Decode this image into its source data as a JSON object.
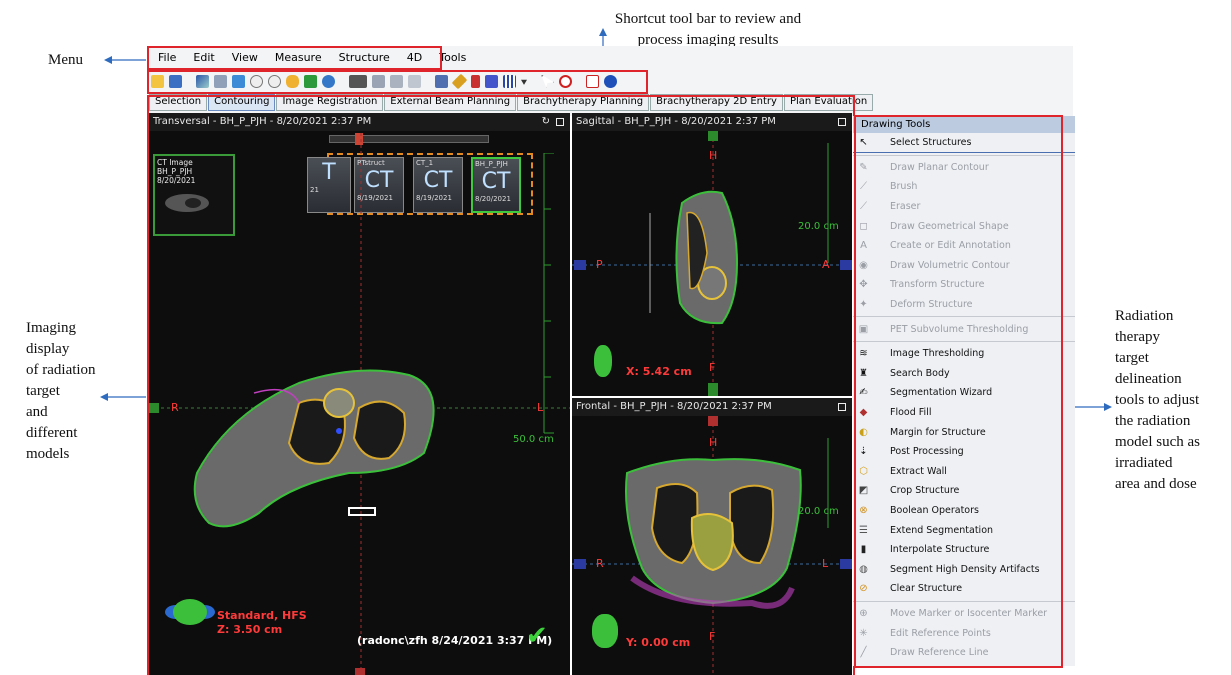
{
  "annotations": {
    "menu": "Menu",
    "shortcut": [
      "Shortcut tool bar to review and",
      "process imaging results"
    ],
    "imaging": [
      "Imaging",
      "display",
      "of radiation",
      "target",
      "and",
      "different",
      "models"
    ],
    "radiation": [
      "Radiation",
      "therapy",
      "target",
      "delineation",
      "tools to adjust",
      "the radiation",
      "model such as",
      "irradiated",
      "area and dose"
    ]
  },
  "menu": [
    "File",
    "Edit",
    "View",
    "Measure",
    "Structure",
    "4D",
    "Tools"
  ],
  "tabs": [
    "Selection",
    "Contouring",
    "Image Registration",
    "External Beam Planning",
    "Brachytherapy Planning",
    "Brachytherapy 2D Entry",
    "Plan Evaluation"
  ],
  "active_tab": "Contouring",
  "viewports": {
    "transversal": {
      "title": "Transversal - BH_P_PJH - 8/20/2021 2:37 PM",
      "thumb_label": [
        "CT Image",
        "BH_P_PJH",
        "8/20/2021"
      ],
      "series": [
        {
          "label": "",
          "big": "T",
          "date": "21"
        },
        {
          "label": "RTstruct",
          "big": "CT",
          "date": "8/19/2021"
        },
        {
          "label": "CT_1",
          "big": "CT",
          "date": "8/19/2021"
        },
        {
          "label": "BH_P_PJH",
          "big": "CT",
          "date": "8/20/2021"
        }
      ],
      "axis_left": "R",
      "axis_right": "L",
      "scale": "50.0 cm",
      "orientation": "Standard, HFS",
      "z": "Z: 3.50 cm",
      "footer": "(radonc\\zfh 8/24/2021 3:37 PM)"
    },
    "sagittal": {
      "title": "Sagittal - BH_P_PJH - 8/20/2021 2:37 PM",
      "top": "H",
      "bottom": "F",
      "left": "P",
      "right": "A",
      "scale": "20.0 cm",
      "coord": "X: 5.42 cm"
    },
    "frontal": {
      "title": "Frontal - BH_P_PJH - 8/20/2021 2:37 PM",
      "top": "H",
      "bottom": "F",
      "left": "R",
      "right": "L",
      "scale": "20.0 cm",
      "coord": "Y: 0.00 cm"
    }
  },
  "drawing_tools": {
    "title": "Drawing Tools",
    "items": [
      {
        "label": "Select Structures",
        "enabled": true,
        "icon": "pointer-icon"
      },
      {
        "sep": true
      },
      {
        "label": "Draw Planar Contour",
        "enabled": false,
        "icon": "pen-icon"
      },
      {
        "label": "Brush",
        "enabled": false,
        "icon": "brush-icon"
      },
      {
        "label": "Eraser",
        "enabled": false,
        "icon": "eraser-icon"
      },
      {
        "label": "Draw Geometrical Shape",
        "enabled": false,
        "icon": "shape-icon"
      },
      {
        "label": "Create or Edit Annotation",
        "enabled": false,
        "icon": "annotation-icon"
      },
      {
        "label": "Draw Volumetric Contour",
        "enabled": false,
        "icon": "volume-icon"
      },
      {
        "label": "Transform Structure",
        "enabled": false,
        "icon": "transform-icon"
      },
      {
        "label": "Deform Structure",
        "enabled": false,
        "icon": "deform-icon"
      },
      {
        "sep": true
      },
      {
        "label": "PET Subvolume Thresholding",
        "enabled": false,
        "icon": "pet-icon"
      },
      {
        "sep": true
      },
      {
        "label": "Image Thresholding",
        "enabled": true,
        "icon": "threshold-icon"
      },
      {
        "label": "Search Body",
        "enabled": true,
        "icon": "body-icon"
      },
      {
        "label": "Segmentation Wizard",
        "enabled": true,
        "icon": "wizard-icon"
      },
      {
        "label": "Flood Fill",
        "enabled": true,
        "icon": "flood-icon"
      },
      {
        "label": "Margin for Structure",
        "enabled": true,
        "icon": "margin-icon"
      },
      {
        "label": "Post Processing",
        "enabled": true,
        "icon": "post-icon"
      },
      {
        "label": "Extract Wall",
        "enabled": true,
        "icon": "wall-icon"
      },
      {
        "label": "Crop Structure",
        "enabled": true,
        "icon": "crop-icon"
      },
      {
        "label": "Boolean Operators",
        "enabled": true,
        "icon": "boolean-icon"
      },
      {
        "label": "Extend Segmentation",
        "enabled": true,
        "icon": "extend-icon"
      },
      {
        "label": "Interpolate Structure",
        "enabled": true,
        "icon": "interpolate-icon"
      },
      {
        "label": "Segment High Density Artifacts",
        "enabled": true,
        "icon": "artifact-icon"
      },
      {
        "label": "Clear Structure",
        "enabled": true,
        "icon": "clear-icon"
      },
      {
        "sep": true
      },
      {
        "label": "Move Marker or Isocenter Marker",
        "enabled": false,
        "icon": "marker-icon"
      },
      {
        "label": "Edit Reference Points",
        "enabled": false,
        "icon": "refpoint-icon"
      },
      {
        "label": "Draw Reference Line",
        "enabled": false,
        "icon": "refline-icon"
      }
    ]
  }
}
